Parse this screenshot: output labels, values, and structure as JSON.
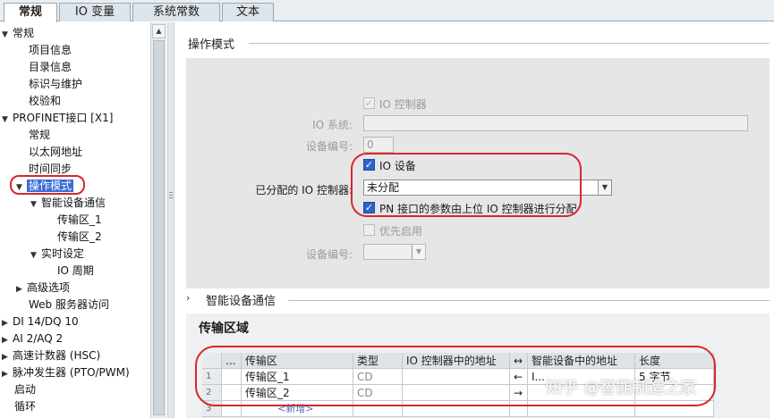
{
  "tabs": [
    {
      "label": "常规"
    },
    {
      "label": "IO 变量"
    },
    {
      "label": "系统常数"
    },
    {
      "label": "文本"
    }
  ],
  "tree": {
    "items": [
      {
        "label": "常规"
      },
      {
        "label": "项目信息"
      },
      {
        "label": "目录信息"
      },
      {
        "label": "标识与维护"
      },
      {
        "label": "校验和"
      },
      {
        "label": "PROFINET接口 [X1]"
      },
      {
        "label": "常规"
      },
      {
        "label": "以太网地址"
      },
      {
        "label": "时间同步"
      },
      {
        "label": "操作模式"
      },
      {
        "label": "智能设备通信"
      },
      {
        "label": "传输区_1"
      },
      {
        "label": "传输区_2"
      },
      {
        "label": "实时设定"
      },
      {
        "label": "IO 周期"
      },
      {
        "label": "高级选项"
      },
      {
        "label": "Web 服务器访问"
      },
      {
        "label": "DI 14/DQ 10"
      },
      {
        "label": "AI 2/AQ 2"
      },
      {
        "label": "高速计数器 (HSC)"
      },
      {
        "label": "脉冲发生器 (PTO/PWM)"
      },
      {
        "label": "启动"
      },
      {
        "label": "循环"
      }
    ]
  },
  "mode_section": {
    "title": "操作模式",
    "io_controller_label": "IO 控制器",
    "io_system_label": "IO 系统:",
    "device_number_label": "设备编号:",
    "device_number_value": "0",
    "io_device_label": "IO 设备",
    "assigned_controller_label": "已分配的 IO 控制器:",
    "assigned_controller_value": "未分配",
    "pn_param_label": "PN 接口的参数由上位 IO 控制器进行分配",
    "priority_label": "优先启用",
    "device_number2_label": "设备编号:"
  },
  "smart_section": {
    "title": "智能设备通信",
    "transfer_title": "传输区域"
  },
  "table": {
    "headers": [
      "...",
      "传输区",
      "类型",
      "IO 控制器中的地址",
      "↔",
      "智能设备中的地址",
      "长度"
    ],
    "rows": [
      {
        "no": "1",
        "name": "传输区_1",
        "type": "CD",
        "ctrl_addr": "",
        "dir": "←",
        "dev_addr": "I...",
        "len": "5 字节"
      },
      {
        "no": "2",
        "name": "传输区_2",
        "type": "CD",
        "ctrl_addr": "",
        "dir": "→",
        "dev_addr": "",
        "len": ""
      },
      {
        "no": "3",
        "name": "<新增>",
        "type": "",
        "ctrl_addr": "",
        "dir": "",
        "dev_addr": "",
        "len": ""
      }
    ]
  },
  "watermark": "知乎 @智能制造之家"
}
